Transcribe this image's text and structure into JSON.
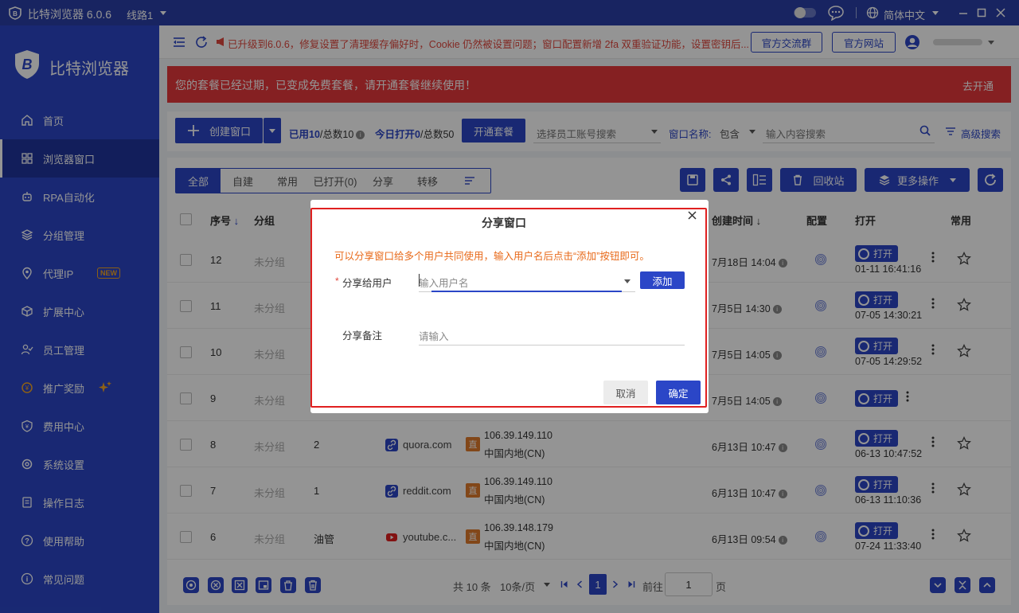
{
  "titlebar": {
    "app_name": "比特浏览器 6.0.6",
    "line": "线路1",
    "language": "简体中文"
  },
  "colors": {
    "primary": "#2b46c7",
    "sidebar": "#2b46c7",
    "titlebar": "#2a3ea8",
    "alert": "#e5383b",
    "notice": "#e0483e",
    "highlight": "#e02020"
  },
  "brand": {
    "name": "比特浏览器"
  },
  "sidebar": {
    "items": [
      {
        "label": "首页",
        "icon": "home-icon"
      },
      {
        "label": "浏览器窗口",
        "icon": "grid-icon"
      },
      {
        "label": "RPA自动化",
        "icon": "robot-icon"
      },
      {
        "label": "分组管理",
        "icon": "layers-icon"
      },
      {
        "label": "代理IP",
        "icon": "location-icon",
        "badge": "NEW"
      },
      {
        "label": "扩展中心",
        "icon": "cube-icon"
      },
      {
        "label": "员工管理",
        "icon": "users-icon"
      },
      {
        "label": "推广奖励",
        "icon": "reward-icon"
      },
      {
        "label": "费用中心",
        "icon": "shield-icon"
      },
      {
        "label": "系统设置",
        "icon": "settings-icon"
      },
      {
        "label": "操作日志",
        "icon": "log-icon"
      },
      {
        "label": "使用帮助",
        "icon": "help-icon"
      },
      {
        "label": "常见问题",
        "icon": "info-icon"
      }
    ]
  },
  "topbar": {
    "notice": "已升级到6.0.6，修复设置了清理缓存偏好时，Cookie 仍然被设置问题；窗口配置新增 2fa 双重验证功能，设置密钥后...",
    "community_btn": "官方交流群",
    "website_btn": "官方网站"
  },
  "alert": {
    "text": "您的套餐已经过期，已变成免费套餐，请开通套餐继续使用！",
    "action": "去开通"
  },
  "toolbar": {
    "create_btn": "创建窗口",
    "used_label": "已用",
    "used_value": "10",
    "total_label": "/总数10",
    "opened_label": "今日打开",
    "opened_value": "0",
    "opened_total": "/总数50",
    "subscribe_btn": "开通套餐",
    "staff_placeholder": "选择员工账号搜索",
    "name_filter_label": "窗口名称:",
    "name_filter_op": "包含",
    "search_placeholder": "输入内容搜索",
    "advanced": "高级搜索"
  },
  "tabs": [
    "全部",
    "自建",
    "常用",
    "已打开(0)",
    "分享",
    "转移"
  ],
  "actions": {
    "recycle": "回收站",
    "more": "更多操作"
  },
  "table": {
    "headers": {
      "seq": "序号",
      "group": "分组",
      "created": "创建时间",
      "config": "配置",
      "open": "打开",
      "fav": "常用"
    },
    "rows": [
      {
        "seq": "12",
        "group": "未分组",
        "created": "7月18日 14:04",
        "open_label": "打开",
        "open_time": "01-11 16:41:16"
      },
      {
        "seq": "11",
        "group": "未分组",
        "created": "7月5日 14:30",
        "open_label": "打开",
        "open_time": "07-05 14:30:21"
      },
      {
        "seq": "10",
        "group": "未分组",
        "created": "7月5日 14:05",
        "open_label": "打开",
        "open_time": "07-05 14:29:52"
      },
      {
        "seq": "9",
        "group": "未分组",
        "created": "7月5日 14:05",
        "open_label": "打开",
        "open_time": ""
      },
      {
        "seq": "8",
        "group": "未分组",
        "name": "2",
        "platform": "quora.com",
        "ip_type": "直",
        "ip": "106.39.149.110",
        "region": "中国内地(CN)",
        "created": "6月13日 10:47",
        "open_label": "打开",
        "open_time": "06-13 10:47:52"
      },
      {
        "seq": "7",
        "group": "未分组",
        "name": "1",
        "platform": "reddit.com",
        "ip_type": "直",
        "ip": "106.39.149.110",
        "region": "中国内地(CN)",
        "created": "6月13日 10:47",
        "open_label": "打开",
        "open_time": "06-13 11:10:36"
      },
      {
        "seq": "6",
        "group": "未分组",
        "name": "油管",
        "platform": "youtube.c...",
        "ip_type": "直",
        "ip": "106.39.148.179",
        "region": "中国内地(CN)",
        "created": "6月13日 09:54",
        "open_label": "打开",
        "open_time": "07-24 11:33:40"
      }
    ]
  },
  "pagination": {
    "total": "共 10 条",
    "page_size": "10条/页",
    "current": "1",
    "goto_label": "前往",
    "goto_value": "1",
    "page_unit": "页"
  },
  "dialog": {
    "title": "分享窗口",
    "tip": "可以分享窗口给多个用户共同使用，输入用户名后点击“添加”按钮即可。",
    "user_label": "分享给用户",
    "user_placeholder": "输入用户名",
    "add_btn": "添加",
    "note_label": "分享备注",
    "note_placeholder": "请输入",
    "cancel_btn": "取消",
    "confirm_btn": "确定"
  }
}
